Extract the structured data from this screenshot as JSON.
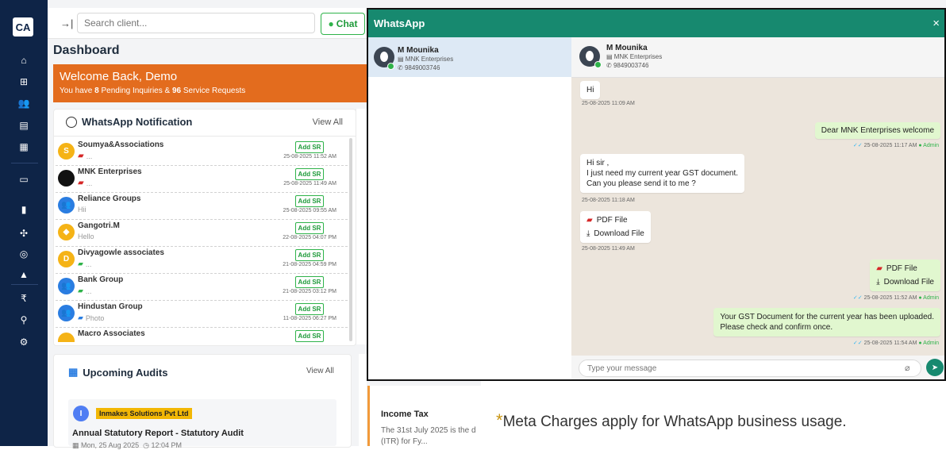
{
  "sidebar": {
    "logo": "CA"
  },
  "topbar": {
    "search_placeholder": "Search client...",
    "chat_label": "Chat"
  },
  "dashboard": {
    "title": "Dashboard",
    "welcome": "Welcome Back, Demo",
    "summary_prefix": "You have ",
    "pending_count": "8",
    "summary_mid": " Pending Inquiries & ",
    "service_count": "96",
    "summary_suffix": " Service Requests"
  },
  "whatsapp_notifications": {
    "title": "WhatsApp Notification",
    "view_all": "View All",
    "add_sr_label": "Add SR",
    "items": [
      {
        "initial": "S",
        "name": "Soumya&Associations",
        "message": "...",
        "time": "25-08-2025 11:52 AM"
      },
      {
        "initial": "",
        "name": "MNK Enterprises",
        "message": "...",
        "time": "25-08-2025 11:49 AM"
      },
      {
        "initial": "",
        "name": "Reliance Groups",
        "message": "Hii",
        "time": "25-08-2025 09:55 AM"
      },
      {
        "initial": "",
        "name": "Gangotri.M",
        "message": "Hello",
        "time": "22-08-2025 04:07 PM"
      },
      {
        "initial": "D",
        "name": "Divyagowle associates",
        "message": "...",
        "time": "21-08-2025 04:59 PM"
      },
      {
        "initial": "",
        "name": "Bank Group",
        "message": "...",
        "time": "21-08-2025 03:12 PM"
      },
      {
        "initial": "",
        "name": "Hindustan Group",
        "message": "Photo",
        "time": "11-08-2025 06:27 PM"
      },
      {
        "initial": "",
        "name": "Macro Associates",
        "message": "",
        "time": ""
      }
    ]
  },
  "audits": {
    "title": "Upcoming Audits",
    "view_all": "View All",
    "item": {
      "initial": "I",
      "company": "Inmakes Solutions Pvt Ltd",
      "title": "Annual Statutory Report - Statutory Audit",
      "date": "Mon, 25 Aug 2025",
      "time": "12:04 PM"
    }
  },
  "tax": {
    "title": "Income Tax",
    "text": "The 31st July 2025 is the d (ITR) for Fy..."
  },
  "meta_note": "Meta Charges apply for WhatsApp business usage.",
  "whatsapp": {
    "title": "WhatsApp",
    "close": "×",
    "contact": {
      "name": "M Mounika",
      "company": "MNK Enterprises",
      "phone": "9849003746"
    },
    "messages": {
      "m1": {
        "text": "Hi",
        "time": "25-08-2025 11:09 AM"
      },
      "m2": {
        "text": "Dear MNK Enterprises welcome",
        "time": "25-08-2025 11:17 AM",
        "by": "Admin"
      },
      "m3": {
        "line1": "Hi sir ,",
        "line2": "I just need my current year GST document.",
        "line3": "Can you please send it to me ?",
        "time": "25-08-2025 11:18 AM"
      },
      "m4": {
        "file": "PDF File",
        "download": "Download File",
        "time": "25-08-2025 11:49 AM"
      },
      "m5": {
        "file": "PDF File",
        "download": "Download File",
        "time": "25-08-2025 11:52 AM",
        "by": "Admin"
      },
      "m6": {
        "line1": "Your GST Document for the current year has been uploaded.",
        "line2": "Please check and confirm once.",
        "time": "25-08-2025 11:54 AM",
        "by": "Admin"
      }
    },
    "input_placeholder": "Type your message"
  },
  "colors": {
    "sidebar": "#0e2447",
    "banner": "#e36c1e",
    "whatsapp_header": "#17896f",
    "chat_bg": "#ece5dc",
    "outgoing": "#e1f7cf"
  }
}
